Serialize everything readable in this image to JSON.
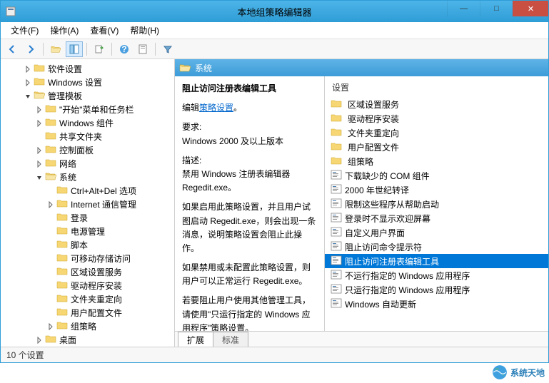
{
  "window": {
    "title": "本地组策略编辑器"
  },
  "menu": {
    "file": "文件(F)",
    "action": "操作(A)",
    "view": "查看(V)",
    "help": "帮助(H)"
  },
  "tree": [
    {
      "indent": 2,
      "toggle": "right",
      "icon": "folder",
      "label": "软件设置"
    },
    {
      "indent": 2,
      "toggle": "right",
      "icon": "folder",
      "label": "Windows 设置"
    },
    {
      "indent": 2,
      "toggle": "down",
      "icon": "folder-open",
      "label": "管理模板"
    },
    {
      "indent": 3,
      "toggle": "right",
      "icon": "folder",
      "label": "\"开始\"菜单和任务栏"
    },
    {
      "indent": 3,
      "toggle": "right",
      "icon": "folder",
      "label": "Windows 组件"
    },
    {
      "indent": 3,
      "toggle": "empty",
      "icon": "folder",
      "label": "共享文件夹"
    },
    {
      "indent": 3,
      "toggle": "right",
      "icon": "folder",
      "label": "控制面板"
    },
    {
      "indent": 3,
      "toggle": "right",
      "icon": "folder",
      "label": "网络"
    },
    {
      "indent": 3,
      "toggle": "down",
      "icon": "folder-open",
      "label": "系统"
    },
    {
      "indent": 4,
      "toggle": "empty",
      "icon": "folder",
      "label": "Ctrl+Alt+Del 选项"
    },
    {
      "indent": 4,
      "toggle": "right",
      "icon": "folder",
      "label": "Internet 通信管理"
    },
    {
      "indent": 4,
      "toggle": "empty",
      "icon": "folder",
      "label": "登录"
    },
    {
      "indent": 4,
      "toggle": "empty",
      "icon": "folder",
      "label": "电源管理"
    },
    {
      "indent": 4,
      "toggle": "empty",
      "icon": "folder",
      "label": "脚本"
    },
    {
      "indent": 4,
      "toggle": "empty",
      "icon": "folder",
      "label": "可移动存储访问"
    },
    {
      "indent": 4,
      "toggle": "empty",
      "icon": "folder",
      "label": "区域设置服务"
    },
    {
      "indent": 4,
      "toggle": "empty",
      "icon": "folder",
      "label": "驱动程序安装"
    },
    {
      "indent": 4,
      "toggle": "empty",
      "icon": "folder",
      "label": "文件夹重定向"
    },
    {
      "indent": 4,
      "toggle": "empty",
      "icon": "folder",
      "label": "用户配置文件"
    },
    {
      "indent": 4,
      "toggle": "right",
      "icon": "folder",
      "label": "组策略"
    },
    {
      "indent": 3,
      "toggle": "right",
      "icon": "folder",
      "label": "桌面"
    }
  ],
  "rightHeader": {
    "title": "系统"
  },
  "desc": {
    "policyTitle": "阻止访问注册表编辑工具",
    "editPrefix": "编辑",
    "editLink": "策略设置",
    "reqLabel": "要求:",
    "reqText": "Windows 2000 及以上版本",
    "descLabel": "描述:",
    "p1": "禁用 Windows 注册表编辑器 Regedit.exe。",
    "p2": "如果启用此策略设置，并且用户试图启动 Regedit.exe，则会出现一条消息，说明策略设置会阻止此操作。",
    "p3": "如果禁用或未配置此策略设置，则用户可以正常运行 Regedit.exe。",
    "p4": "若要阻止用户使用其他管理工具，请使用\"只运行指定的 Windows 应用程序\"策略设置。"
  },
  "listHeader": "设置",
  "list": [
    {
      "icon": "folder",
      "label": "区域设置服务"
    },
    {
      "icon": "folder",
      "label": "驱动程序安装"
    },
    {
      "icon": "folder",
      "label": "文件夹重定向"
    },
    {
      "icon": "folder",
      "label": "用户配置文件"
    },
    {
      "icon": "folder",
      "label": "组策略"
    },
    {
      "icon": "setting",
      "label": "下载缺少的 COM 组件"
    },
    {
      "icon": "setting",
      "label": "2000 年世纪转译"
    },
    {
      "icon": "setting",
      "label": "限制这些程序从帮助启动"
    },
    {
      "icon": "setting",
      "label": "登录时不显示欢迎屏幕"
    },
    {
      "icon": "setting",
      "label": "自定义用户界面"
    },
    {
      "icon": "setting",
      "label": "阻止访问命令提示符"
    },
    {
      "icon": "setting",
      "label": "阻止访问注册表编辑工具",
      "selected": true
    },
    {
      "icon": "setting",
      "label": "不运行指定的 Windows 应用程序"
    },
    {
      "icon": "setting",
      "label": "只运行指定的 Windows 应用程序"
    },
    {
      "icon": "setting",
      "label": "Windows 自动更新"
    }
  ],
  "tabs": {
    "extended": "扩展",
    "standard": "标准"
  },
  "status": "10 个设置",
  "watermark": "系统天地"
}
